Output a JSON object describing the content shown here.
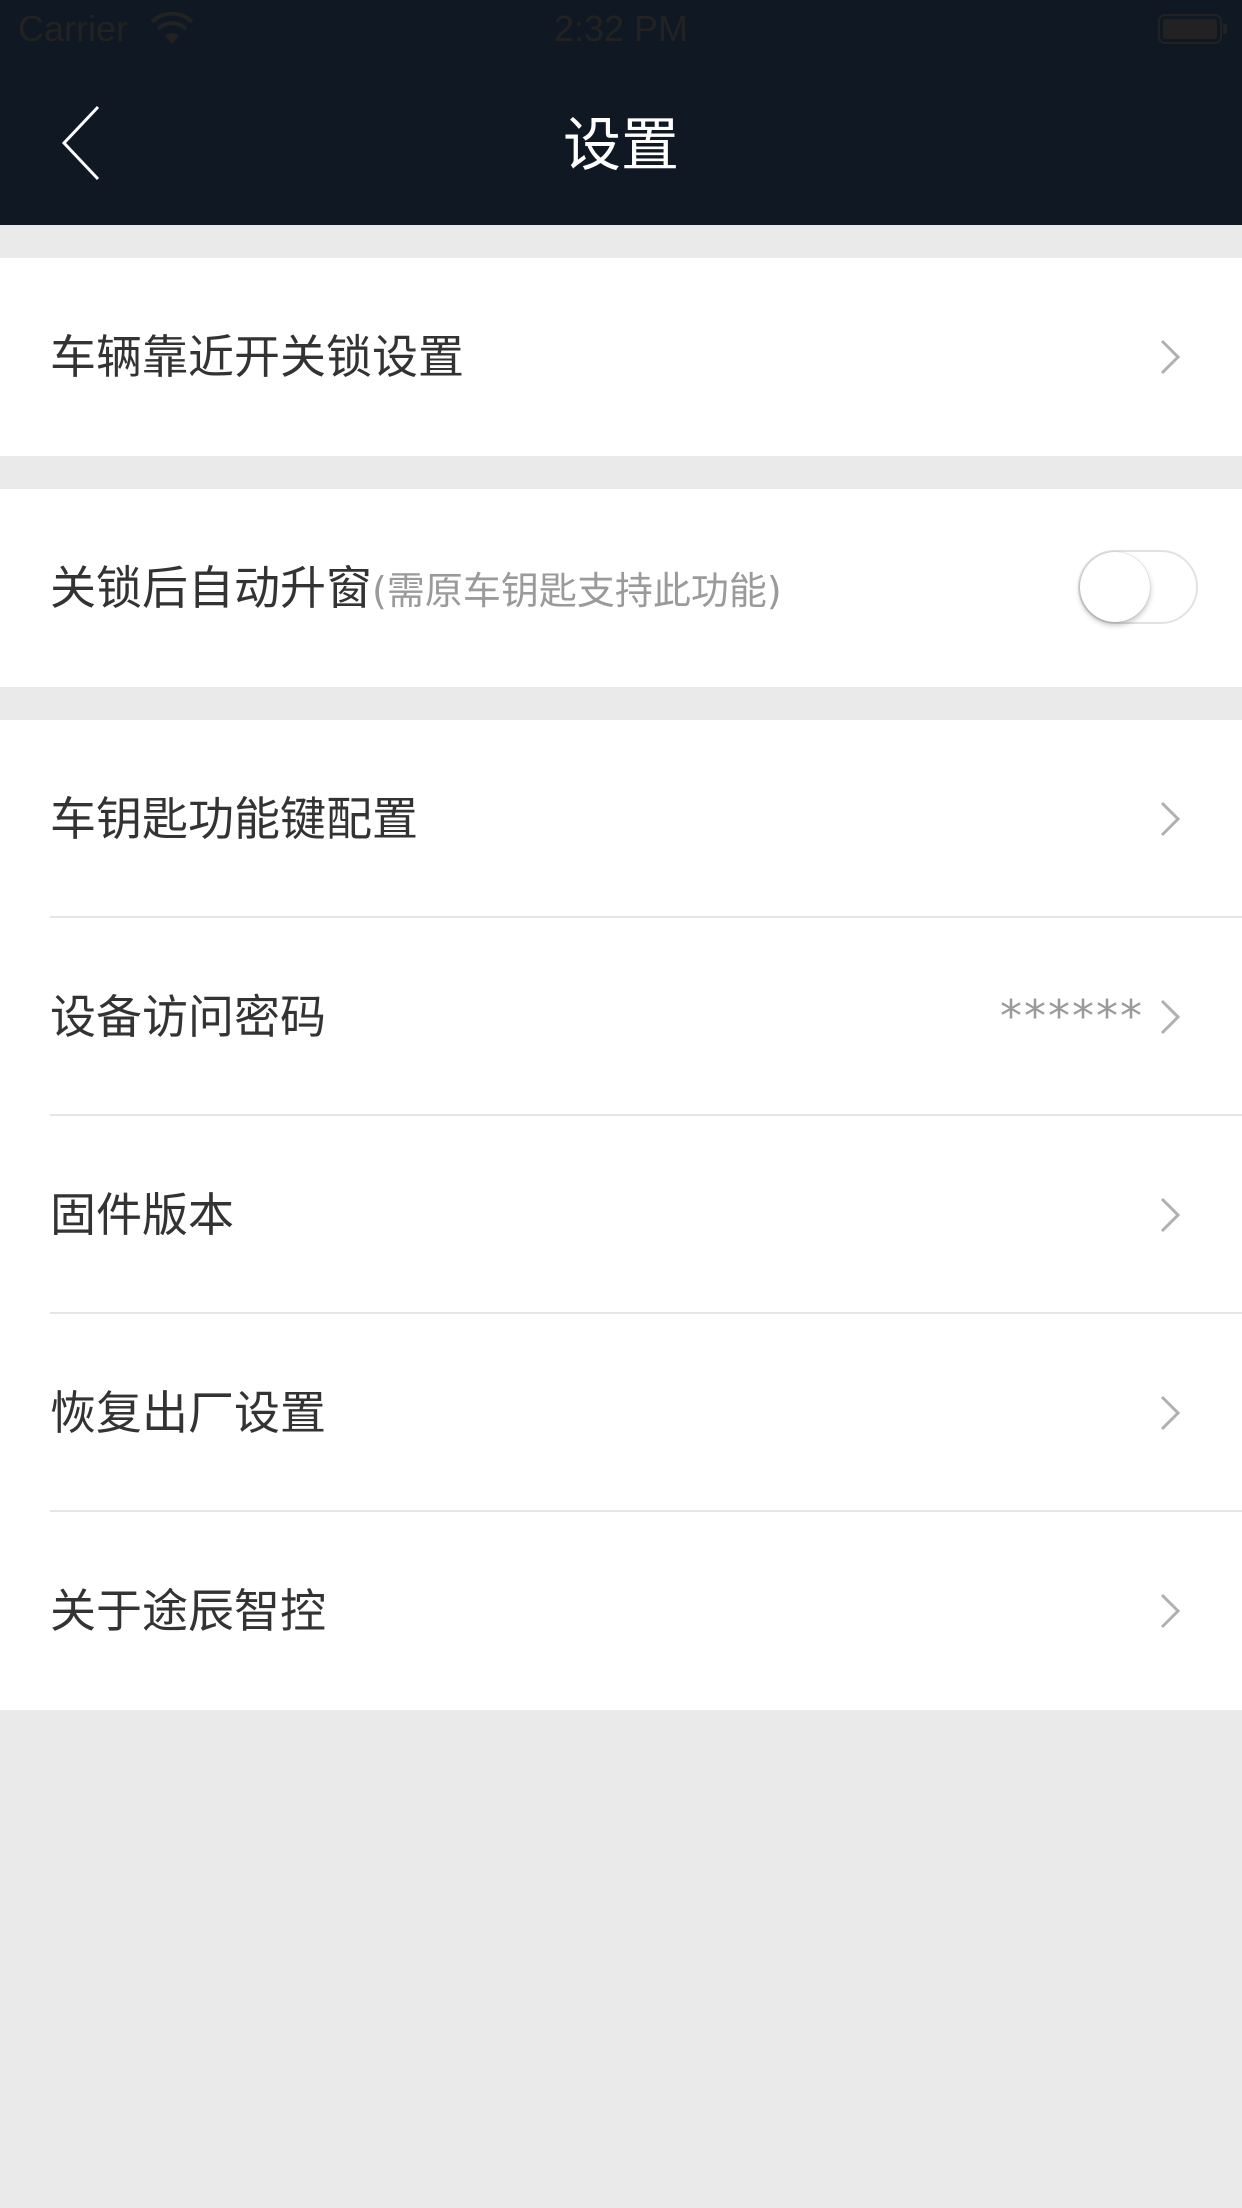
{
  "status_bar": {
    "carrier": "Carrier",
    "time": "2:32 PM",
    "wifi_icon": "wifi-icon",
    "battery_icon": "battery-icon"
  },
  "nav": {
    "title": "设置",
    "back_icon": "chevron-left-icon",
    "background": "#101824"
  },
  "groups": [
    {
      "rows": [
        {
          "label": "车辆靠近开关锁设置",
          "chevron": true
        }
      ]
    },
    {
      "rows": [
        {
          "label": "关锁后自动升窗",
          "sublabel": "(需原车钥匙支持此功能)",
          "toggle_on": false
        }
      ]
    },
    {
      "rows": [
        {
          "label": "车钥匙功能键配置",
          "chevron": true
        },
        {
          "label": "设备访问密码",
          "value": "******",
          "chevron": true
        },
        {
          "label": "固件版本",
          "chevron": true
        },
        {
          "label": "恢复出厂设置",
          "chevron": true
        },
        {
          "label": "关于途辰智控",
          "chevron": true
        }
      ]
    }
  ],
  "colors": {
    "page_background": "#eaeaea",
    "row_background": "#ffffff",
    "text": "#333333",
    "secondary_text": "#9a9a9a"
  }
}
